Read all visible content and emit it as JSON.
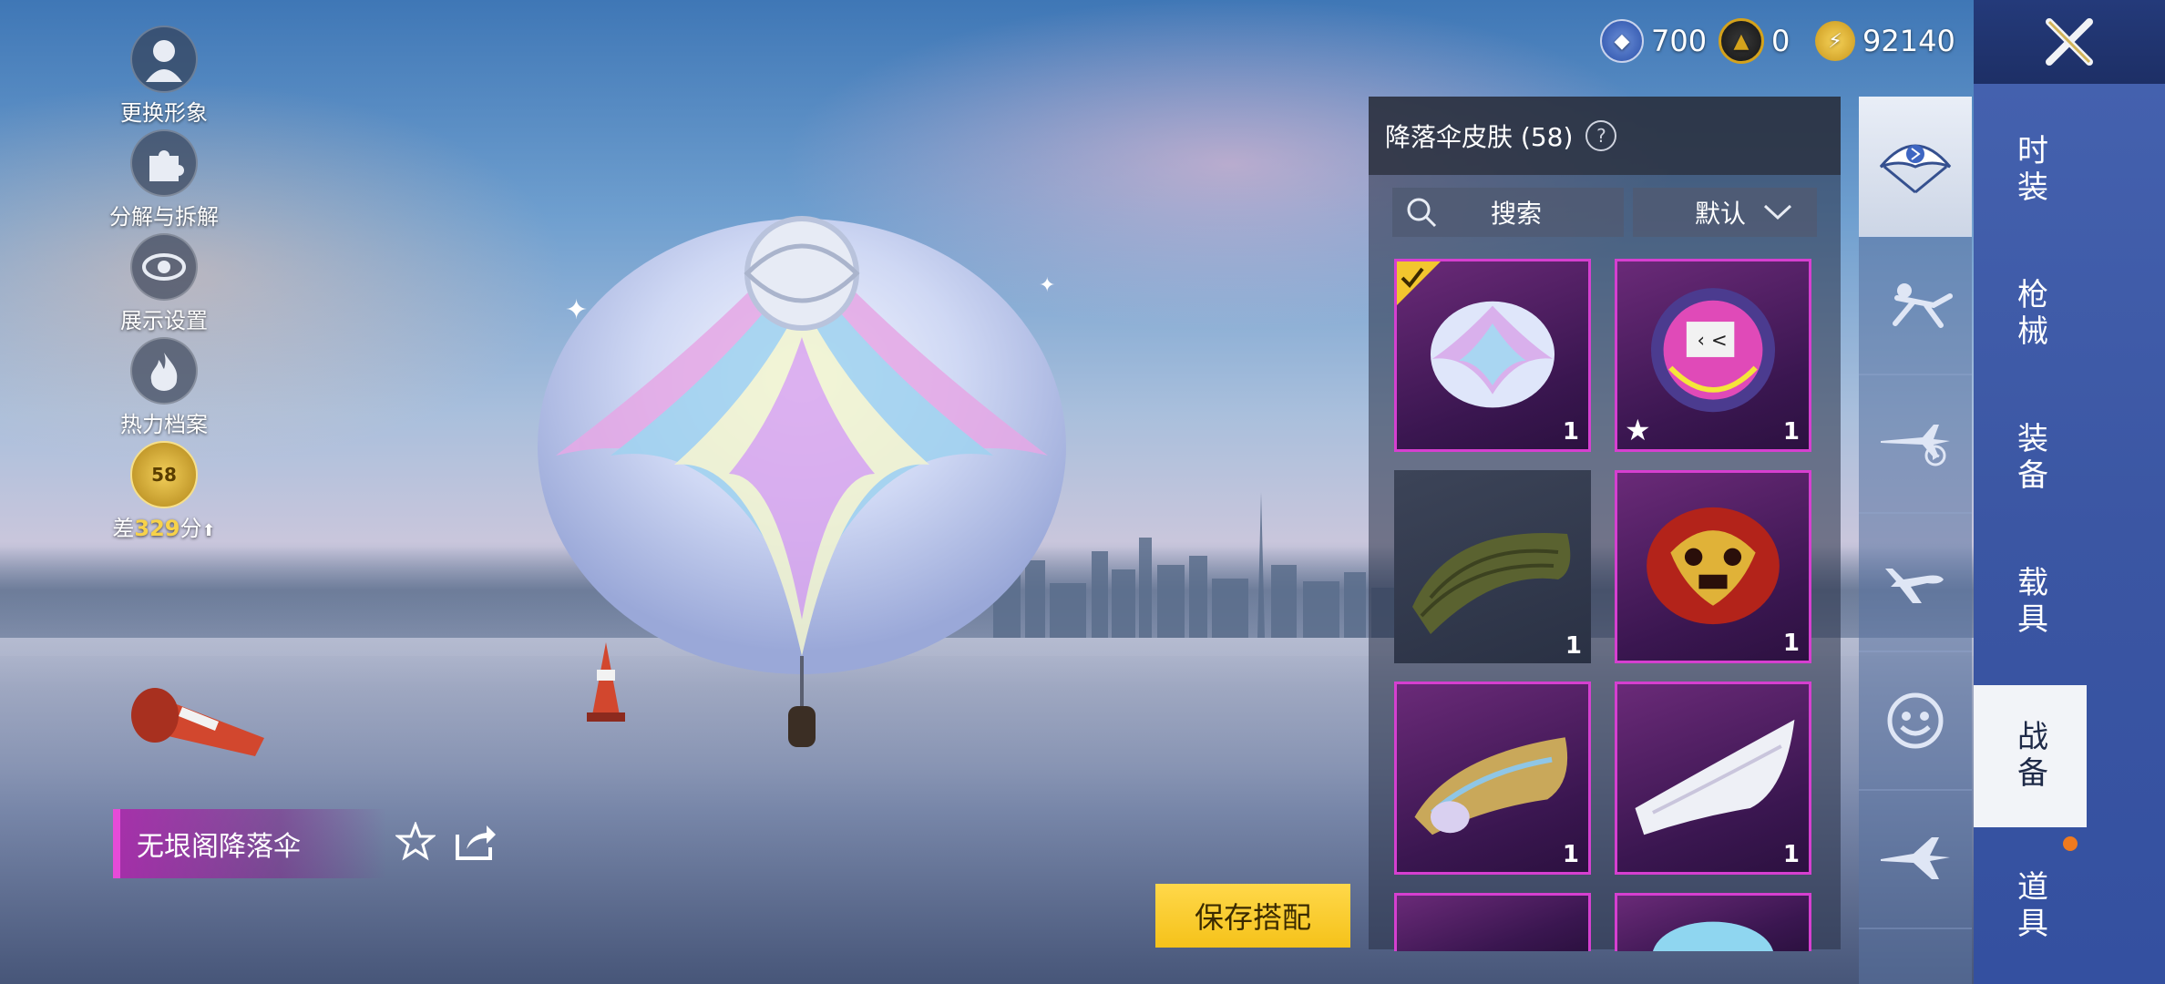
{
  "left_menu": [
    {
      "label": "更换形象",
      "icon": "avatar-icon"
    },
    {
      "label": "分解与拆解",
      "icon": "puzzle-icon"
    },
    {
      "label": "展示设置",
      "icon": "eye-icon"
    },
    {
      "label": "热力档案",
      "icon": "flame-icon"
    }
  ],
  "rank": {
    "level": "58",
    "prefix": "差",
    "points": "329",
    "suffix": "分"
  },
  "currencies": [
    {
      "icon": "uc-icon",
      "value": "700",
      "color": "#2a4fa8"
    },
    {
      "icon": "ag-icon",
      "value": "0",
      "color": "#d4a21c"
    },
    {
      "icon": "bp-icon",
      "value": "92140",
      "color": "#e2b42a"
    }
  ],
  "panel": {
    "title": "降落伞皮肤 (58)",
    "help": "?",
    "search_label": "搜索",
    "sort_label": "默认"
  },
  "grid_items": [
    {
      "name": "lotus-parachute",
      "qty": "1",
      "selected": true
    },
    {
      "name": "graffiti-parachute",
      "qty": "1",
      "starred": true
    },
    {
      "name": "olive-parachute",
      "qty": "1"
    },
    {
      "name": "red-mask-parachute",
      "qty": "1"
    },
    {
      "name": "gold-wing-parachute",
      "qty": "1"
    },
    {
      "name": "white-wing-parachute",
      "qty": "1"
    }
  ],
  "category_icons": [
    "parachute-icon",
    "skydiver-icon",
    "plane-camera-icon",
    "airplane-icon",
    "emote-icon",
    "glider-icon"
  ],
  "main_tabs": [
    "时装",
    "枪械",
    "装备",
    "载具",
    "战备",
    "道具"
  ],
  "active_main_tab": "战备",
  "item_name": "无垠阁降落伞",
  "save_label": "保存搭配",
  "colors": {
    "accent_pink": "#d63fd0",
    "save_yellow": "#f5c21a",
    "nav_blue": "#3b56a3"
  }
}
